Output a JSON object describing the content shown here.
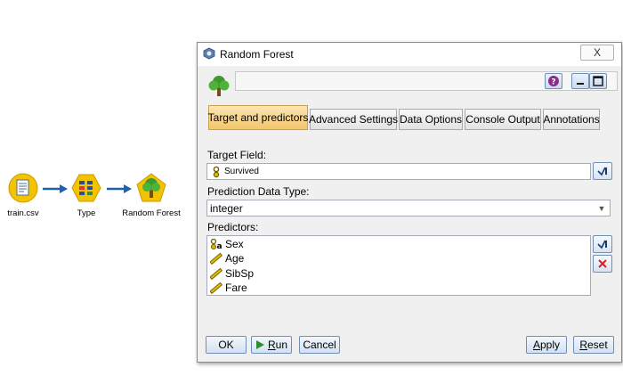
{
  "stream": {
    "nodes": [
      {
        "label": "train.csv",
        "icon": "file-source-icon"
      },
      {
        "label": "Type",
        "icon": "type-node-icon"
      },
      {
        "label": "Random Forest",
        "icon": "tree-icon"
      }
    ]
  },
  "dialog": {
    "title": "Random Forest",
    "close_symbol": "X",
    "node_name_value": "",
    "tabs": [
      {
        "label": "Target and predictors",
        "active": true
      },
      {
        "label": "Advanced Settings",
        "active": false
      },
      {
        "label": "Data Options",
        "active": false
      },
      {
        "label": "Console Output",
        "active": false
      },
      {
        "label": "Annotations",
        "active": false
      }
    ],
    "target_field": {
      "label": "Target Field:",
      "value": "Survived",
      "icon": "flag-field-icon"
    },
    "prediction_type": {
      "label": "Prediction Data Type:",
      "value": "integer"
    },
    "predictors": {
      "label": "Predictors:",
      "items": [
        {
          "name": "Sex",
          "icon": "nominal-field-icon"
        },
        {
          "name": "Age",
          "icon": "continuous-field-icon"
        },
        {
          "name": "SibSp",
          "icon": "continuous-field-icon"
        },
        {
          "name": "Fare",
          "icon": "continuous-field-icon"
        }
      ]
    },
    "buttons": {
      "ok": "OK",
      "run": "Run",
      "run_mnemonic": "R",
      "run_rest": "un",
      "cancel": "Cancel",
      "apply": "Apply",
      "apply_mnemonic": "A",
      "apply_rest": "pply",
      "reset": "Reset",
      "reset_mnemonic": "R",
      "reset_rest": "eset"
    },
    "colors": {
      "active_tab": "#f4c66d",
      "button_border": "#6f8fb9",
      "node_yellow": "#f3c300",
      "arrow_blue": "#1f5fb0"
    }
  }
}
